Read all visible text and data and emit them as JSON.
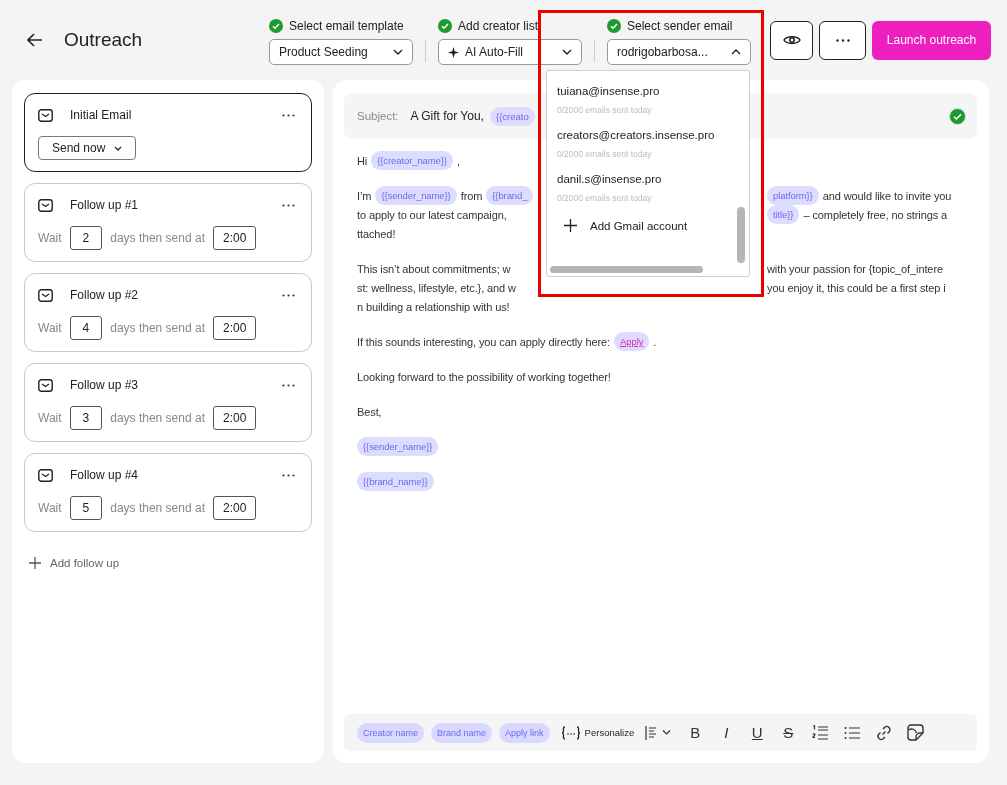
{
  "header": {
    "title": "Outreach"
  },
  "steps": [
    {
      "label": "Select email template",
      "done": true,
      "value": "Product Seeding",
      "kind": "select",
      "expanded": false
    },
    {
      "label": "Add creator list",
      "done": true,
      "value": "AI Auto-Fill",
      "kind": "sparkle-select",
      "expanded": false
    },
    {
      "label": "Select sender email",
      "done": true,
      "value": "rodrigobarbosa...",
      "kind": "select",
      "expanded": true
    }
  ],
  "actions": {
    "launch": "Launch outreach"
  },
  "sequence": [
    {
      "kind": "initial",
      "title": "Initial Email",
      "selected": true,
      "send_mode": "Send now"
    },
    {
      "kind": "follow_up",
      "title": "Follow up #1",
      "selected": false,
      "wait_label": "Wait",
      "days": "2",
      "then_label": "days then send at",
      "time": "2:00"
    },
    {
      "kind": "follow_up",
      "title": "Follow up #2",
      "selected": false,
      "wait_label": "Wait",
      "days": "4",
      "then_label": "days then send at",
      "time": "2:00"
    },
    {
      "kind": "follow_up",
      "title": "Follow up #3",
      "selected": false,
      "wait_label": "Wait",
      "days": "3",
      "then_label": "days then send at",
      "time": "2:00"
    },
    {
      "kind": "follow_up",
      "title": "Follow up #4",
      "selected": false,
      "wait_label": "Wait",
      "days": "5",
      "then_label": "days then send at",
      "time": "2:00"
    }
  ],
  "add_follow_up": "Add follow up",
  "sender_menu": {
    "options": [
      {
        "email": "tuiana@insense.pro",
        "usage": "0/2000 emails sent today"
      },
      {
        "email": "creators@creators.insense.pro",
        "usage": "0/2000 emails sent today"
      },
      {
        "email": "danil.s@insense.pro",
        "usage": "0/2000 emails sent today"
      }
    ],
    "add_account": "Add Gmail account"
  },
  "subject": {
    "label": "Subject:",
    "parts": [
      {
        "kind": "text",
        "text": "A Gift for You,"
      },
      {
        "kind": "chip",
        "text": "{{creato"
      }
    ],
    "verified": true
  },
  "body": [
    {
      "lines": [
        {
          "start": [
            {
              "kind": "text",
              "text": "Hi"
            },
            {
              "kind": "chip",
              "text": "{{creator_name}}"
            },
            {
              "kind": "text",
              "text": ","
            }
          ]
        }
      ]
    },
    {
      "lines": [
        {
          "start": [
            {
              "kind": "text",
              "text": "I’m"
            },
            {
              "kind": "chip",
              "text": "{{sender_name}}"
            },
            {
              "kind": "text",
              "text": "from"
            },
            {
              "kind": "chip",
              "text": "{{brand_"
            }
          ],
          "end": [
            {
              "kind": "chip",
              "text": "platform}}"
            },
            {
              "kind": "text",
              "text": "and would like to invite you"
            }
          ]
        },
        {
          "start": [
            {
              "kind": "text",
              "text": "to apply to our latest campaign,"
            }
          ],
          "end": [
            {
              "kind": "chip",
              "text": "title}}"
            },
            {
              "kind": "text",
              "text": "– completely free, no strings a"
            }
          ]
        },
        {
          "start": [
            {
              "kind": "text",
              "text": "ttached!"
            }
          ]
        }
      ]
    },
    {
      "lines": [
        {
          "start": [
            {
              "kind": "text",
              "text": "This isn’t about commitments; w"
            }
          ],
          "end": [
            {
              "kind": "text",
              "text": "with your passion for {topic_of_intere"
            }
          ]
        },
        {
          "start": [
            {
              "kind": "text",
              "text": "st: wellness, lifestyle, etc.}, and w"
            }
          ],
          "end": [
            {
              "kind": "text",
              "text": "you enjoy it, this could be a first step i"
            }
          ]
        },
        {
          "start": [
            {
              "kind": "text",
              "text": "n building a relationship with us!"
            }
          ]
        }
      ]
    },
    {
      "lines": [
        {
          "start": [
            {
              "kind": "text",
              "text": "If this sounds interesting, you can apply directly here:"
            },
            {
              "kind": "link",
              "text": "Apply"
            },
            {
              "kind": "text",
              "text": "."
            }
          ]
        }
      ]
    },
    {
      "lines": [
        {
          "start": [
            {
              "kind": "text",
              "text": "Looking forward to the possibility of working together!"
            }
          ]
        }
      ]
    },
    {
      "lines": [
        {
          "start": [
            {
              "kind": "text",
              "text": "Best,"
            }
          ]
        }
      ]
    },
    {
      "lines": [
        {
          "start": [
            {
              "kind": "chip",
              "text": "{{sender_name}}"
            }
          ]
        }
      ]
    },
    {
      "lines": [
        {
          "start": [
            {
              "kind": "chip",
              "text": "{{brand_name}}"
            }
          ]
        }
      ]
    }
  ],
  "toolbar": {
    "chips": [
      "Creator name",
      "Brand name",
      "Apply link"
    ],
    "personalize": "Personalize",
    "formats": [
      {
        "kind": "bold",
        "text": "B"
      },
      {
        "kind": "italic",
        "text": "I"
      },
      {
        "kind": "underline",
        "text": "U"
      },
      {
        "kind": "strike",
        "text": "S"
      }
    ]
  }
}
